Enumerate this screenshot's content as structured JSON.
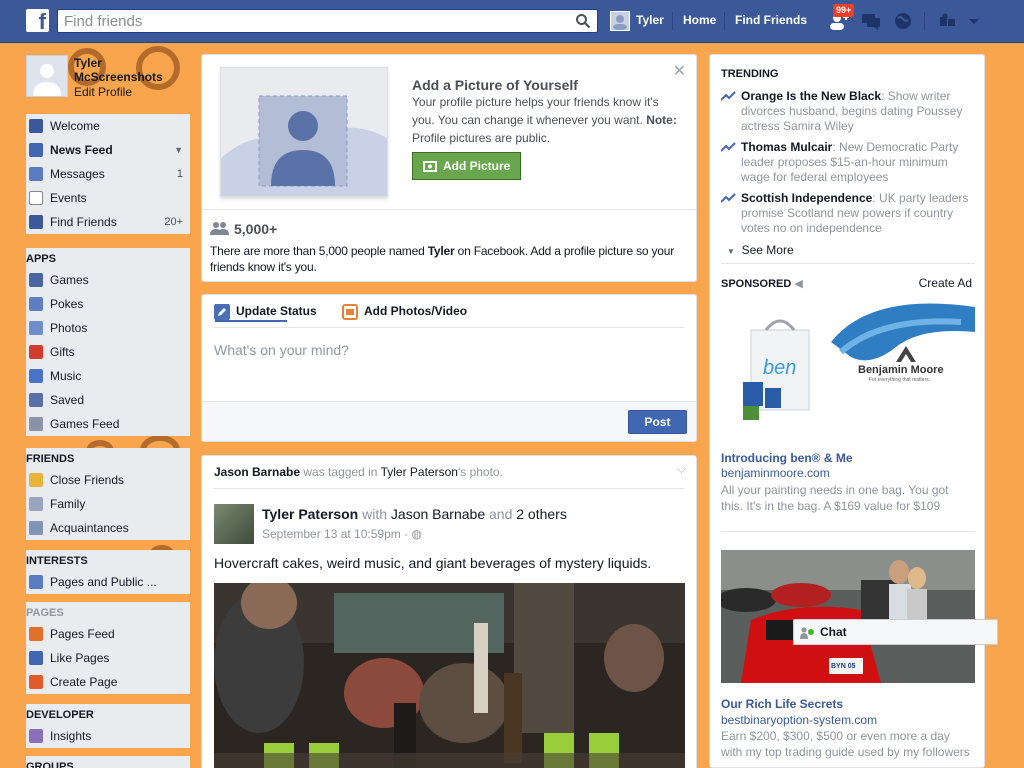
{
  "app": {
    "accent": "#3b5998",
    "background_accent": "#f9a54d"
  },
  "topbar": {
    "search_placeholder": "Find friends",
    "user_name": "Tyler",
    "home": "Home",
    "find_friends": "Find Friends",
    "notifications_badge": "99+"
  },
  "left": {
    "profile_name": "Tyler McScreenshots",
    "edit_profile": "Edit Profile",
    "favorites": [
      {
        "label": "Welcome",
        "icon": "facebook-icon",
        "count": ""
      },
      {
        "label": "News Feed",
        "icon": "news-feed-icon",
        "count": ""
      },
      {
        "label": "Messages",
        "icon": "messages-icon",
        "count": "1"
      },
      {
        "label": "Events",
        "icon": "calendar-icon",
        "count": ""
      },
      {
        "label": "Find Friends",
        "icon": "friends-icon",
        "count": "20+"
      }
    ],
    "apps_header": "APPS",
    "apps": [
      {
        "label": "Games",
        "icon": "games-icon"
      },
      {
        "label": "Pokes",
        "icon": "pokes-icon"
      },
      {
        "label": "Photos",
        "icon": "photos-icon"
      },
      {
        "label": "Gifts",
        "icon": "gifts-icon"
      },
      {
        "label": "Music",
        "icon": "music-icon"
      },
      {
        "label": "Saved",
        "icon": "saved-icon"
      },
      {
        "label": "Games Feed",
        "icon": "controller-icon"
      }
    ],
    "friends_header": "FRIENDS",
    "friends": [
      {
        "label": "Close Friends",
        "icon": "star-icon"
      },
      {
        "label": "Family",
        "icon": "family-icon"
      },
      {
        "label": "Acquaintances",
        "icon": "acquaintances-icon"
      }
    ],
    "interests_header": "INTERESTS",
    "interests": [
      {
        "label": "Pages and Public ...",
        "icon": "rss-icon"
      }
    ],
    "pages_header": "PAGES",
    "pages": [
      {
        "label": "Pages Feed",
        "icon": "megaphone-icon"
      },
      {
        "label": "Like Pages",
        "icon": "thumbs-up-icon"
      },
      {
        "label": "Create Page",
        "icon": "plus-icon"
      }
    ],
    "developer_header": "DEVELOPER",
    "developer": [
      {
        "label": "Insights",
        "icon": "insights-icon"
      }
    ],
    "groups_header": "GROUPS"
  },
  "profile_prompt": {
    "title": "Add a Picture of Yourself",
    "text": "Your profile picture helps your friends know it's you. You can change it whenever you want.",
    "note_label": "Note:",
    "note_text": " Profile pictures are public.",
    "button": "Add Picture",
    "count": "5,000+",
    "desc_before": "There are more than 5,000 people named ",
    "desc_name": "Tyler",
    "desc_after": " on Facebook. Add a profile picture so your friends know it's you."
  },
  "composer": {
    "tab_status": "Update Status",
    "tab_photos": "Add Photos/Video",
    "placeholder": "What's on your mind?",
    "post": "Post"
  },
  "story": {
    "context_actor": "Jason Barnabe",
    "context_mid": " was tagged in ",
    "context_owner": "Tyler Paterson",
    "context_end": "'s photo.",
    "author": "Tyler Paterson",
    "with": " with ",
    "with_name": "Jason Barnabe",
    "and": " and ",
    "others": "2 others",
    "timestamp": "September 13 at 10:59pm",
    "separator": " · ",
    "text": "Hovercraft cakes, weird music, and giant beverages of mystery liquids."
  },
  "right": {
    "trending_header": "TRENDING",
    "trends": [
      {
        "topic": "Orange Is the New Black",
        "desc": ": Show writer divorces husband, begins dating Poussey actress Samira Wiley"
      },
      {
        "topic": "Thomas Mulcair",
        "desc": ": New Democratic Party leader proposes $15-an-hour minimum wage for federal employees"
      },
      {
        "topic": "Scottish Independence",
        "desc": ": UK party leaders promise Scotland new powers if country votes no on independence"
      }
    ],
    "see_more": "See More",
    "sponsored_header": "SPONSORED",
    "create_ad": "Create Ad",
    "ad1": {
      "brand": "Benjamin Moore",
      "brand_tagline": "For everything that matters.",
      "bag_text": "ben",
      "title": "Introducing ben® & Me",
      "url": "benjaminmoore.com",
      "text": "All your painting needs in one bag. You got this. It's in the bag. A $169 value for $109"
    },
    "ad2": {
      "plate": "BYN 05",
      "title": "Our Rich Life Secrets",
      "url": "bestbinaryoption-system.com",
      "text": "Earn $200, $300, $500 or even more a day with my top trading guide used by my followers"
    }
  },
  "chat": {
    "label": "Chat"
  }
}
